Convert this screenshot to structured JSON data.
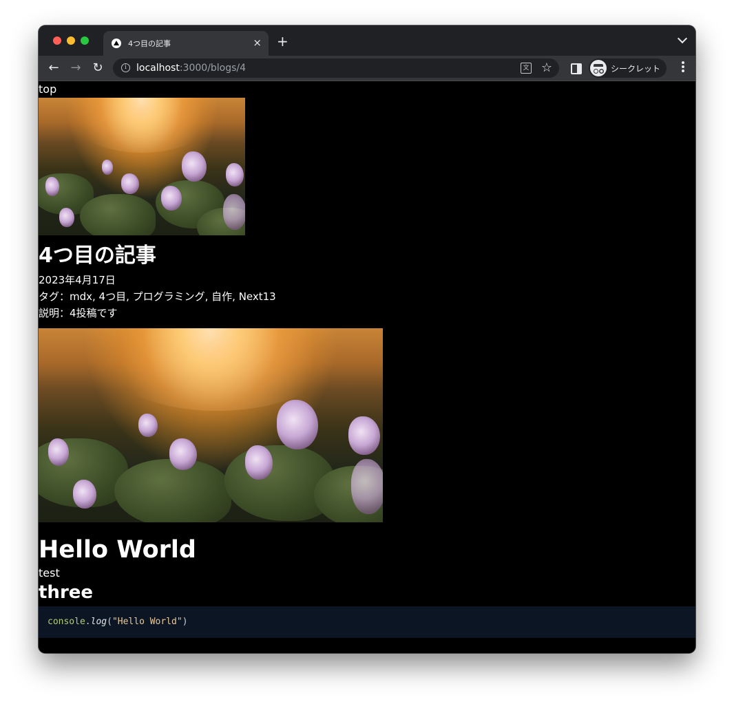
{
  "browser": {
    "tab_title": "4つ目の記事",
    "tab_close": "×",
    "new_tab": "+",
    "url_host": "localhost",
    "url_path": ":3000/blogs/4",
    "info_glyph": "i",
    "translate_glyph": "文",
    "star_glyph": "☆",
    "incognito_label": "シークレット",
    "back_glyph": "←",
    "forward_glyph": "→",
    "reload_glyph": "↻"
  },
  "page": {
    "top_link": "top",
    "title": "4つ目の記事",
    "date": "2023年4月17日",
    "tags": "タグ：mdx, 4つ目, プログラミング, 自作, Next13",
    "description": "説明：4投稿です",
    "heading_hello": "Hello World",
    "paragraph_test": "test",
    "heading_three": "three",
    "code": {
      "object": "console",
      "dot": ".",
      "method": "log",
      "open": "(",
      "string": "\"Hello World\"",
      "close": ")"
    }
  },
  "colors": {
    "tabbar": "#202124",
    "toolbar": "#35363a",
    "page_background": "#000000",
    "code_background": "#0b1524"
  }
}
